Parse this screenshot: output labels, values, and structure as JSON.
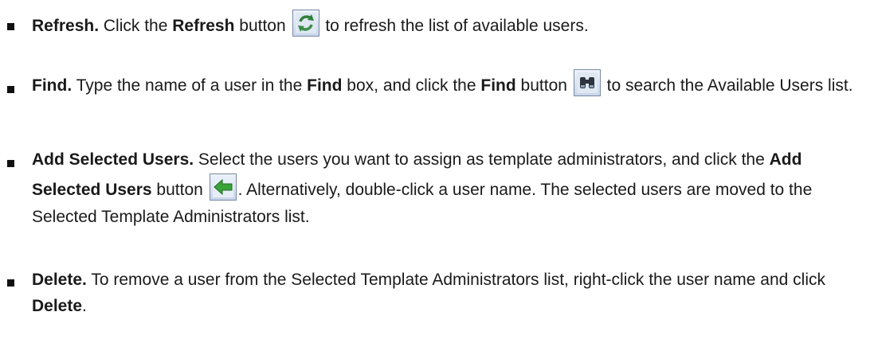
{
  "bullets": [
    {
      "term": "Refresh.",
      "t1": " Click the ",
      "b1": "Refresh",
      "t2": " button ",
      "icon": "refresh-icon",
      "t3": " to refresh the list of available users."
    },
    {
      "term": "Find.",
      "t1": " Type the name of a user in the ",
      "b1": "Find",
      "t2": " box, and click the ",
      "b2": "Find",
      "t3": " button ",
      "icon": "binoculars-icon",
      "t4": " to search the Available Users list."
    },
    {
      "term": "Add Selected Users.",
      "t1": " Select the users you want to assign as template administrators, and click the ",
      "b1": "Add Selected Users",
      "t2": " button ",
      "icon": "add-arrow-icon",
      "t3": ". Alternatively, double-click a user name. The selected users are moved to the Selected Template Administrators list."
    },
    {
      "term": "Delete.",
      "t1": " To remove a user from the Selected Template Administrators list, right-click the user name and click ",
      "b1": "Delete",
      "t2": "."
    }
  ]
}
